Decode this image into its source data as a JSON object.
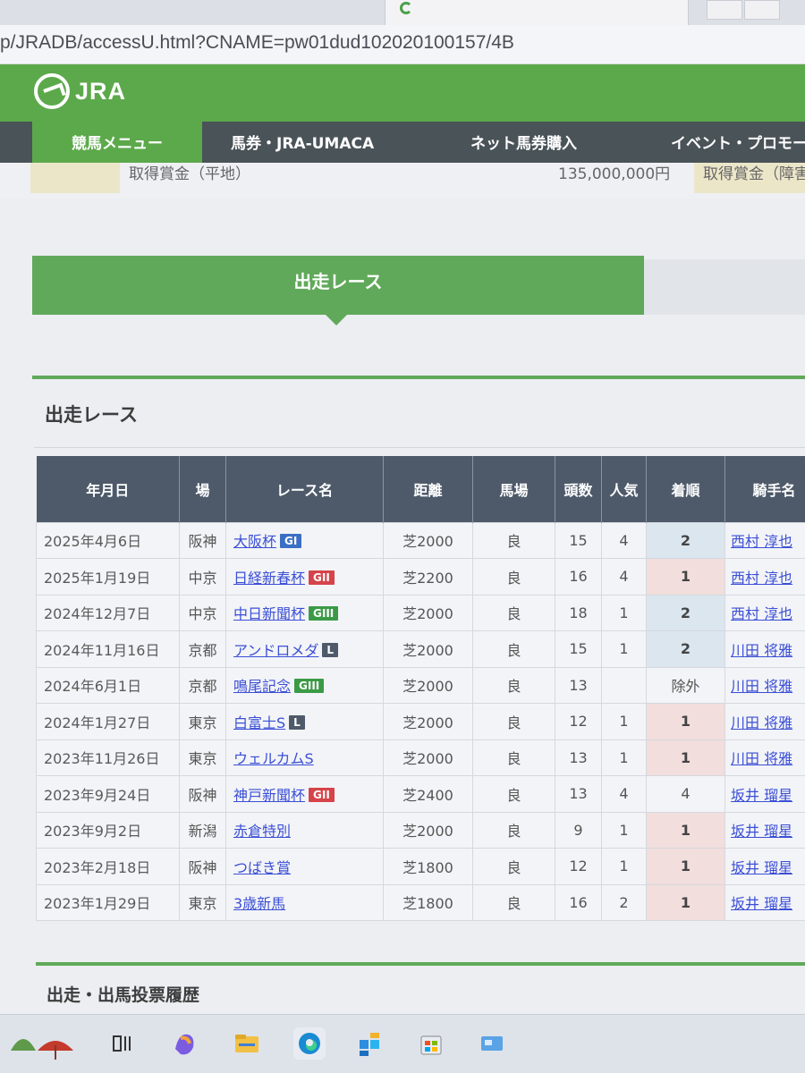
{
  "browser": {
    "url": "p/JRADB/accessU.html?CNAME=pw01dud102020100157/4B"
  },
  "site": {
    "logo_text": "JRA",
    "nav": [
      {
        "label": "競馬メニュー",
        "active": true
      },
      {
        "label": "馬券・JRA-UMACA",
        "active": false
      },
      {
        "label": "ネット馬券購入",
        "active": false
      },
      {
        "label": "イベント・プロモー",
        "active": false
      }
    ]
  },
  "remnant_row": {
    "label_left": "取得賞金（平地）",
    "value": "135,000,000円",
    "label_right": "取得賞金（障害"
  },
  "tab": {
    "label": "出走レース"
  },
  "section": {
    "title": "出走レース",
    "next_title": "出走・出馬投票履歴"
  },
  "table": {
    "headers": [
      "年月日",
      "場",
      "レース名",
      "距離",
      "馬場",
      "頭数",
      "人気",
      "着順",
      "騎手名"
    ],
    "rows": [
      {
        "date": "2025年4月6日",
        "venue": "阪神",
        "race": "大阪杯",
        "grade": "GI",
        "distance": "芝2000",
        "condition": "良",
        "runners": "15",
        "popularity": "4",
        "finish": "2",
        "jockey": "西村 淳也"
      },
      {
        "date": "2025年1月19日",
        "venue": "中京",
        "race": "日経新春杯",
        "grade": "GII",
        "distance": "芝2200",
        "condition": "良",
        "runners": "16",
        "popularity": "4",
        "finish": "1",
        "jockey": "西村 淳也"
      },
      {
        "date": "2024年12月7日",
        "venue": "中京",
        "race": "中日新聞杯",
        "grade": "GIII",
        "distance": "芝2000",
        "condition": "良",
        "runners": "18",
        "popularity": "1",
        "finish": "2",
        "jockey": "西村 淳也"
      },
      {
        "date": "2024年11月16日",
        "venue": "京都",
        "race": "アンドロメダ",
        "grade": "L",
        "distance": "芝2000",
        "condition": "良",
        "runners": "15",
        "popularity": "1",
        "finish": "2",
        "jockey": "川田 将雅"
      },
      {
        "date": "2024年6月1日",
        "venue": "京都",
        "race": "鳴尾記念",
        "grade": "GIII",
        "distance": "芝2000",
        "condition": "良",
        "runners": "13",
        "popularity": "",
        "finish": "除外",
        "jockey": "川田 将雅"
      },
      {
        "date": "2024年1月27日",
        "venue": "東京",
        "race": "白富士S",
        "grade": "L",
        "distance": "芝2000",
        "condition": "良",
        "runners": "12",
        "popularity": "1",
        "finish": "1",
        "jockey": "川田 将雅"
      },
      {
        "date": "2023年11月26日",
        "venue": "東京",
        "race": "ウェルカムS",
        "grade": "",
        "distance": "芝2000",
        "condition": "良",
        "runners": "13",
        "popularity": "1",
        "finish": "1",
        "jockey": "川田 将雅"
      },
      {
        "date": "2023年9月24日",
        "venue": "阪神",
        "race": "神戸新聞杯",
        "grade": "GII",
        "distance": "芝2400",
        "condition": "良",
        "runners": "13",
        "popularity": "4",
        "finish": "4",
        "jockey": "坂井 瑠星"
      },
      {
        "date": "2023年9月2日",
        "venue": "新潟",
        "race": "赤倉特別",
        "grade": "",
        "distance": "芝2000",
        "condition": "良",
        "runners": "9",
        "popularity": "1",
        "finish": "1",
        "jockey": "坂井 瑠星"
      },
      {
        "date": "2023年2月18日",
        "venue": "阪神",
        "race": "つばき賞",
        "grade": "",
        "distance": "芝1800",
        "condition": "良",
        "runners": "12",
        "popularity": "1",
        "finish": "1",
        "jockey": "坂井 瑠星"
      },
      {
        "date": "2023年1月29日",
        "venue": "東京",
        "race": "3歳新馬",
        "grade": "",
        "distance": "芝1800",
        "condition": "良",
        "runners": "16",
        "popularity": "2",
        "finish": "1",
        "jockey": "坂井 瑠星"
      }
    ]
  },
  "grade_colors": {
    "GI": "#3a6fc4",
    "GII": "#d6434a",
    "GIII": "#3b9a46",
    "L": "#4e5a6a"
  },
  "taskbar": {
    "icons": [
      "weather-icon",
      "task-view-icon",
      "copilot-icon",
      "file-explorer-icon",
      "edge-icon",
      "store-icon",
      "microsoft-store-icon",
      "widgets-icon"
    ]
  }
}
